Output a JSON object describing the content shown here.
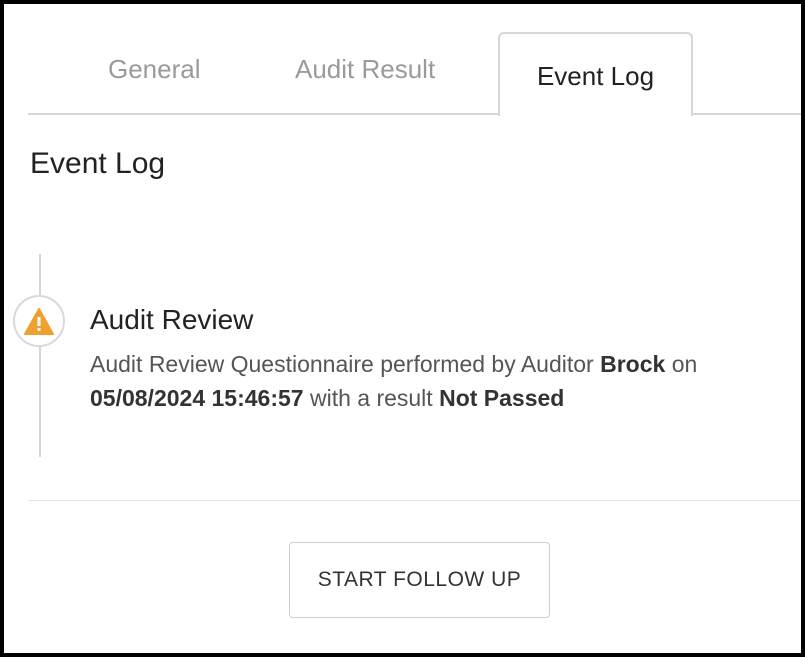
{
  "tabs": [
    {
      "label": "General"
    },
    {
      "label": "Audit Result"
    },
    {
      "label": "Event Log"
    }
  ],
  "section": {
    "title": "Event Log"
  },
  "event": {
    "icon": "warning-icon",
    "icon_color": "#f0a02e",
    "title": "Audit Review",
    "desc_prefix": "Audit Review Questionnaire performed by Auditor ",
    "auditor": "Brock",
    "desc_on": " on ",
    "datetime": "05/08/2024 15:46:57",
    "desc_result": " with a result ",
    "result": "Not Passed"
  },
  "actions": {
    "follow_up_label": "START FOLLOW UP"
  }
}
